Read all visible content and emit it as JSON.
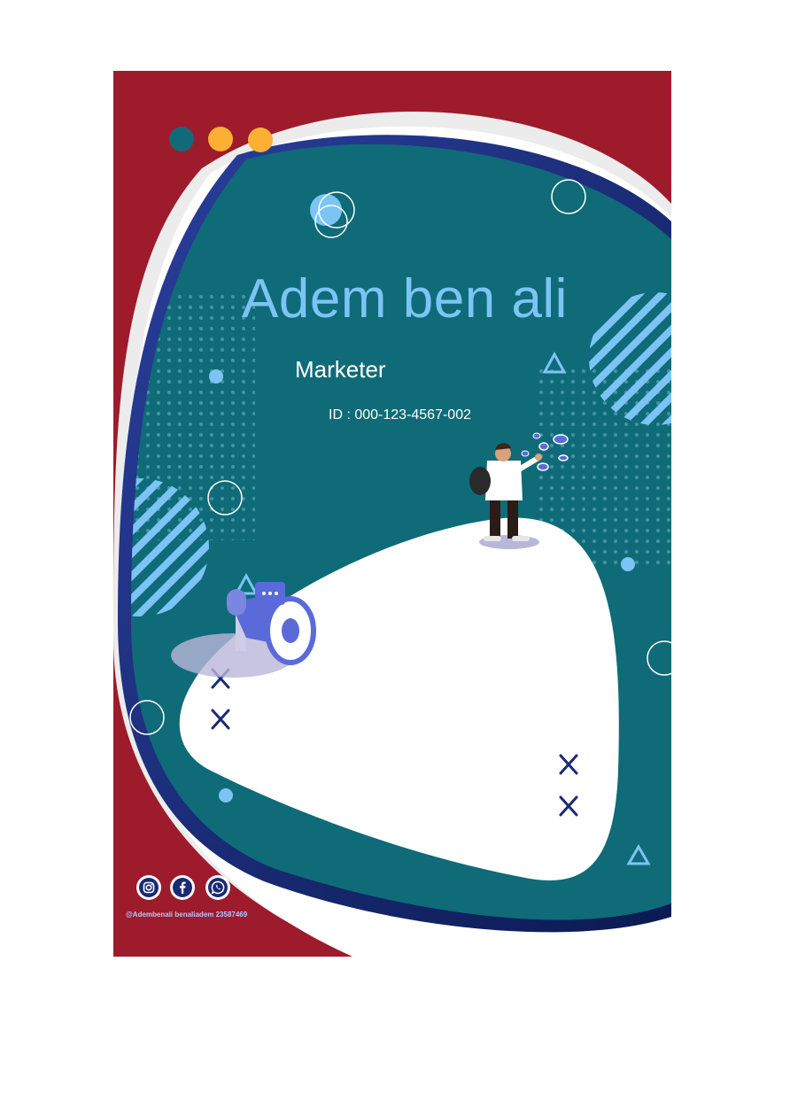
{
  "card": {
    "name": "Adem ben ali",
    "role": "Marketer",
    "id_line": "ID : 000-123-4567-002",
    "handle": "@Adembenali benaliadem  23587469"
  },
  "icons": [
    "instagram-icon",
    "facebook-icon",
    "whatsapp-icon",
    "megaphone-icon",
    "person-illustration"
  ],
  "colors": {
    "red": "#9e1b2c",
    "teal": "#0f6b78",
    "navy": "#1a2a72",
    "light_blue": "#7cc4f5",
    "yellow": "#fbb034"
  }
}
